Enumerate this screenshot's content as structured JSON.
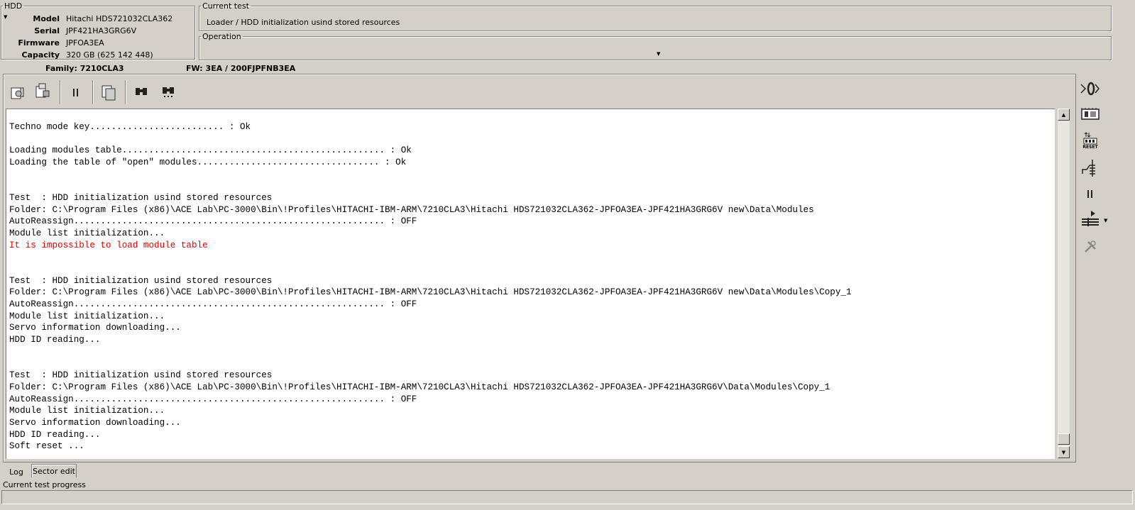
{
  "hdd": {
    "legend": "HDD",
    "model_label": "Model",
    "model": "Hitachi HDS721032CLA362",
    "serial_label": "Serial",
    "serial": "JPF421HA3GRG6V",
    "firmware_label": "Firmware",
    "firmware": "JPFOA3EA",
    "capacity_label": "Capacity",
    "capacity": "320 GB (625 142 448)"
  },
  "current_test": {
    "legend": "Current test",
    "value": "Loader / HDD initialization usind stored resources"
  },
  "operation": {
    "legend": "Operation",
    "value": ""
  },
  "info_bar": {
    "family": "Family: 7210CLA3",
    "fw": "FW:  3EA / 200FJPFNB3EA"
  },
  "toolbar": {
    "icons": [
      "load-config-icon",
      "save-disk-icon",
      "pause-icon",
      "copy-pages-icon",
      "find-icon",
      "find-next-icon"
    ]
  },
  "log_lines": [
    {
      "text": "",
      "error": false
    },
    {
      "text": "Techno mode key......................... : Ok",
      "error": false
    },
    {
      "text": "",
      "error": false
    },
    {
      "text": "Loading modules table................................................. : Ok",
      "error": false
    },
    {
      "text": "Loading the table of \"open\" modules.................................. : Ok",
      "error": false
    },
    {
      "text": "",
      "error": false
    },
    {
      "text": "",
      "error": false
    },
    {
      "text": "Test  : HDD initialization usind stored resources",
      "error": false
    },
    {
      "text": "Folder: C:\\Program Files (x86)\\ACE Lab\\PC-3000\\Bin\\!Profiles\\HITACHI-IBM-ARM\\7210CLA3\\Hitachi HDS721032CLA362-JPFOA3EA-JPF421HA3GRG6V new\\Data\\Modules",
      "error": false
    },
    {
      "text": "AutoReassign.......................................................... : OFF",
      "error": false
    },
    {
      "text": "Module list initialization...",
      "error": false
    },
    {
      "text": "It is impossible to load module table",
      "error": true
    },
    {
      "text": "",
      "error": false
    },
    {
      "text": "",
      "error": false
    },
    {
      "text": "Test  : HDD initialization usind stored resources",
      "error": false
    },
    {
      "text": "Folder: C:\\Program Files (x86)\\ACE Lab\\PC-3000\\Bin\\!Profiles\\HITACHI-IBM-ARM\\7210CLA3\\Hitachi HDS721032CLA362-JPFOA3EA-JPF421HA3GRG6V new\\Data\\Modules\\Copy_1",
      "error": false
    },
    {
      "text": "AutoReassign.......................................................... : OFF",
      "error": false
    },
    {
      "text": "Module list initialization...",
      "error": false
    },
    {
      "text": "Servo information downloading...",
      "error": false
    },
    {
      "text": "HDD ID reading...",
      "error": false
    },
    {
      "text": "",
      "error": false
    },
    {
      "text": "",
      "error": false
    },
    {
      "text": "Test  : HDD initialization usind stored resources",
      "error": false
    },
    {
      "text": "Folder: C:\\Program Files (x86)\\ACE Lab\\PC-3000\\Bin\\!Profiles\\HITACHI-IBM-ARM\\7210CLA3\\Hitachi HDS721032CLA362-JPFOA3EA-JPF421HA3GRG6V\\Data\\Modules\\Copy_1",
      "error": false
    },
    {
      "text": "AutoReassign.......................................................... : OFF",
      "error": false
    },
    {
      "text": "Module list initialization...",
      "error": false
    },
    {
      "text": "Servo information downloading...",
      "error": false
    },
    {
      "text": "HDD ID reading...",
      "error": false
    },
    {
      "text": "Soft reset ...",
      "error": false
    }
  ],
  "tabs": {
    "log": "Log",
    "sector_edit": "Sector edit"
  },
  "right_panel": {
    "icons": [
      "power-icon",
      "pcb-board-icon",
      "reset-icon",
      "jumper-icon",
      "pause-icon",
      "play-layers-icon",
      "tools-icon"
    ],
    "reset_text": "RESET"
  },
  "progress": {
    "label": "Current test progress",
    "value": 0
  },
  "colors": {
    "background": "#d4d0c8",
    "error_text": "#e00000",
    "log_bg": "#ffffff"
  }
}
